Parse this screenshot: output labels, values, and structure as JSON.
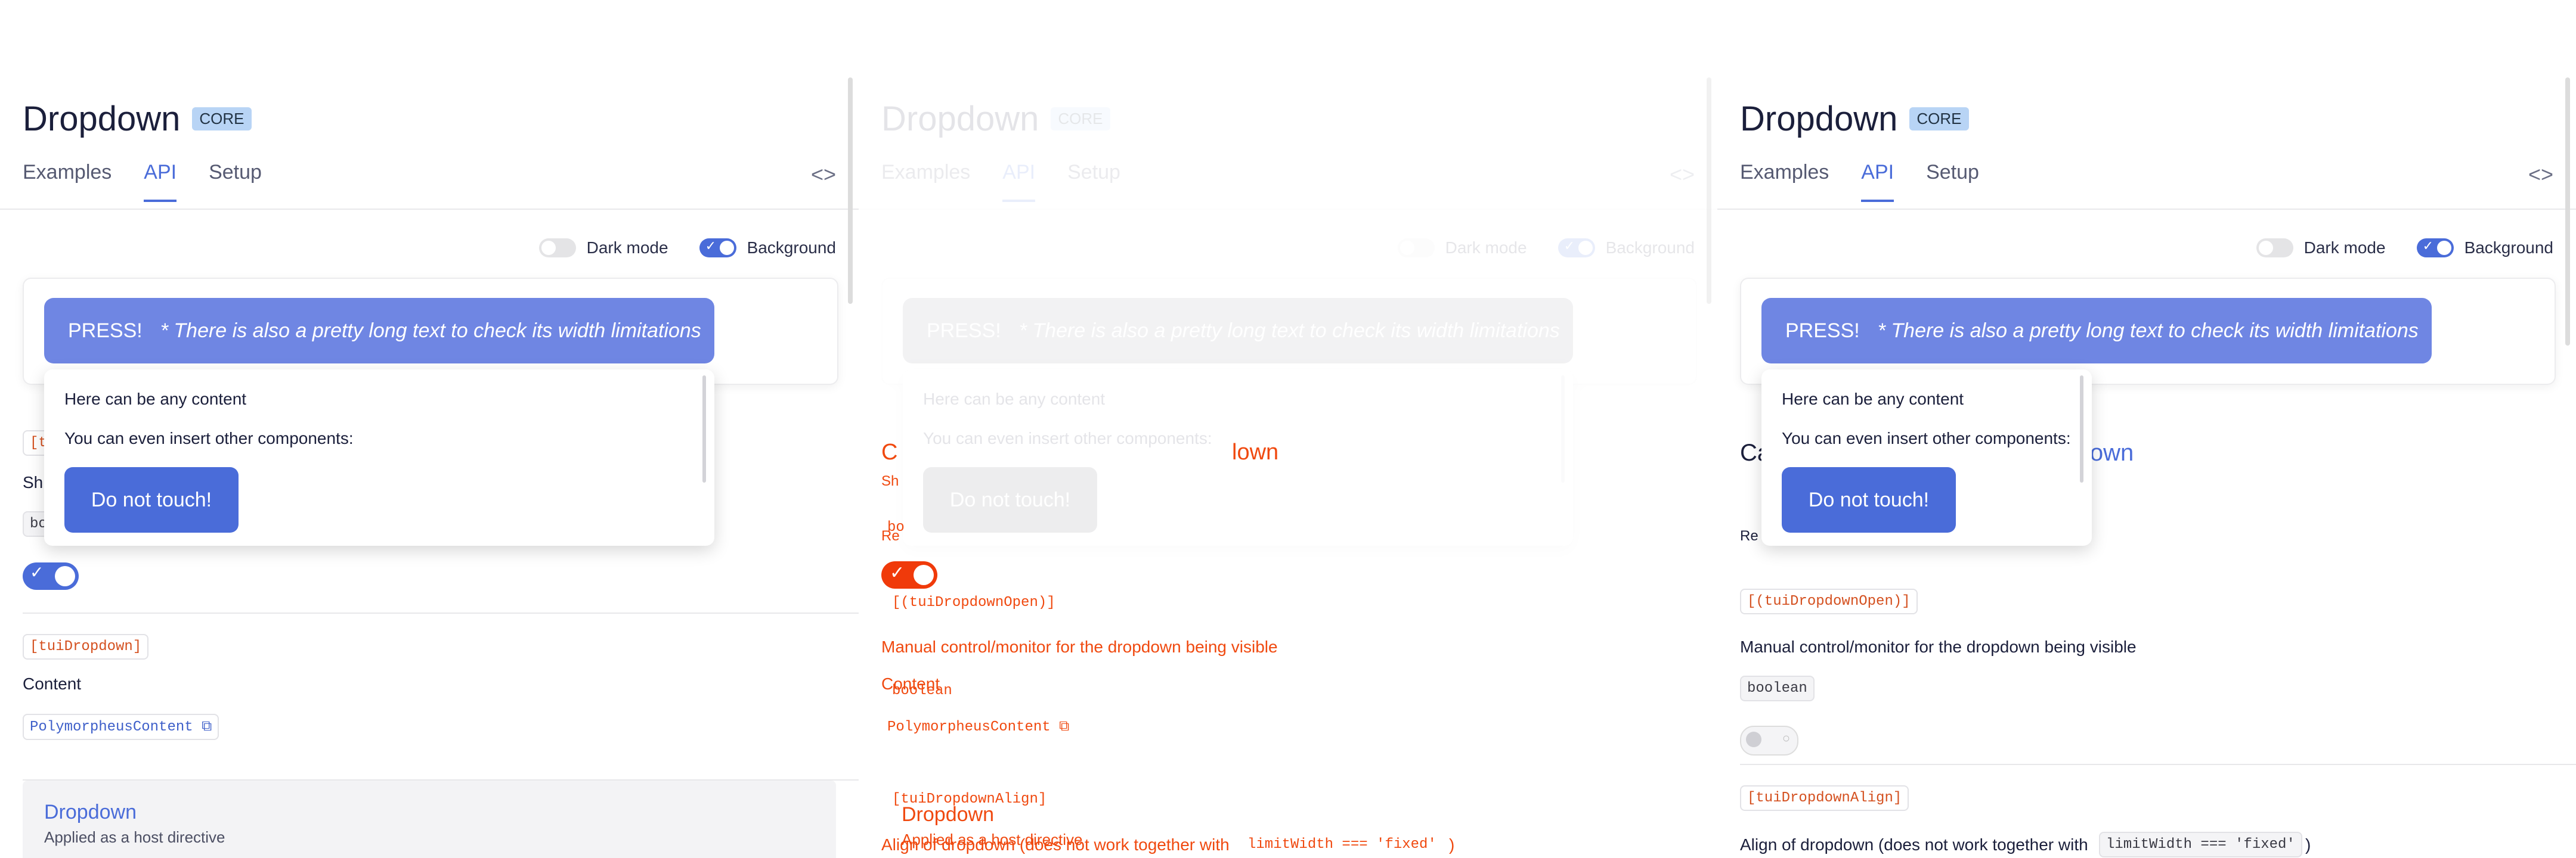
{
  "header": {
    "title": "Dropdown",
    "badge": "CORE",
    "tabs": [
      "Examples",
      "API",
      "Setup"
    ],
    "code_icon": "code-brackets-icon"
  },
  "toggles": {
    "dark_mode": "Dark mode",
    "background": "Background"
  },
  "demo": {
    "press_label": "PRESS!",
    "press_note": "* There is also a pretty long text to check its width limitations",
    "dropdown_text_1": "Here can be any content",
    "dropdown_text_2": "You can even insert other components:",
    "dropdown_button": "Do not touch!"
  },
  "api_left": {
    "partial_code_1": "[t",
    "partial_text_1": "Sh",
    "partial_code_2": "bo",
    "content_code": "[tuiDropdown]",
    "content_label": "Content",
    "content_type": "PolymorpheusContent",
    "host_title": "Dropdown",
    "host_sub": "Applied as a host directive"
  },
  "api_middle": {
    "heading_fragment_1": "C",
    "heading_fragment_2": "lown",
    "sh": "Sh",
    "bo": "bo",
    "re": "Re",
    "open_code": "[(tuiDropdownOpen)]",
    "manual_text": "Manual control/monitor for the dropdown being visible",
    "bool_code": "boolean",
    "content_label": "Content",
    "content_type": "PolymorpheusContent",
    "align_code": "[tuiDropdownAlign]",
    "dropdown_word": "Dropdown",
    "applied_text": "Applied as a host directive",
    "align_text": "Align of dropdown (does not work together with",
    "limit_code": "limitWidth === 'fixed'",
    "close_paren": ")"
  },
  "api_right": {
    "heading_fragment_1": "Ca",
    "heading_fragment_2": "lown",
    "re": "Re",
    "open_code": "[(tuiDropdownOpen)]",
    "manual_text": "Manual control/monitor for the dropdown being visible",
    "bool_code": "boolean",
    "align_code": "[tuiDropdownAlign]",
    "align_text": "Align of dropdown (does not work together with",
    "limit_code": "limitWidth === 'fixed'",
    "close_paren": ")"
  },
  "colors": {
    "accent": "#4a6cd9",
    "press_bg": "#6f86e3",
    "code_orange": "#d4501f",
    "overlay_orange": "#f0490f"
  }
}
